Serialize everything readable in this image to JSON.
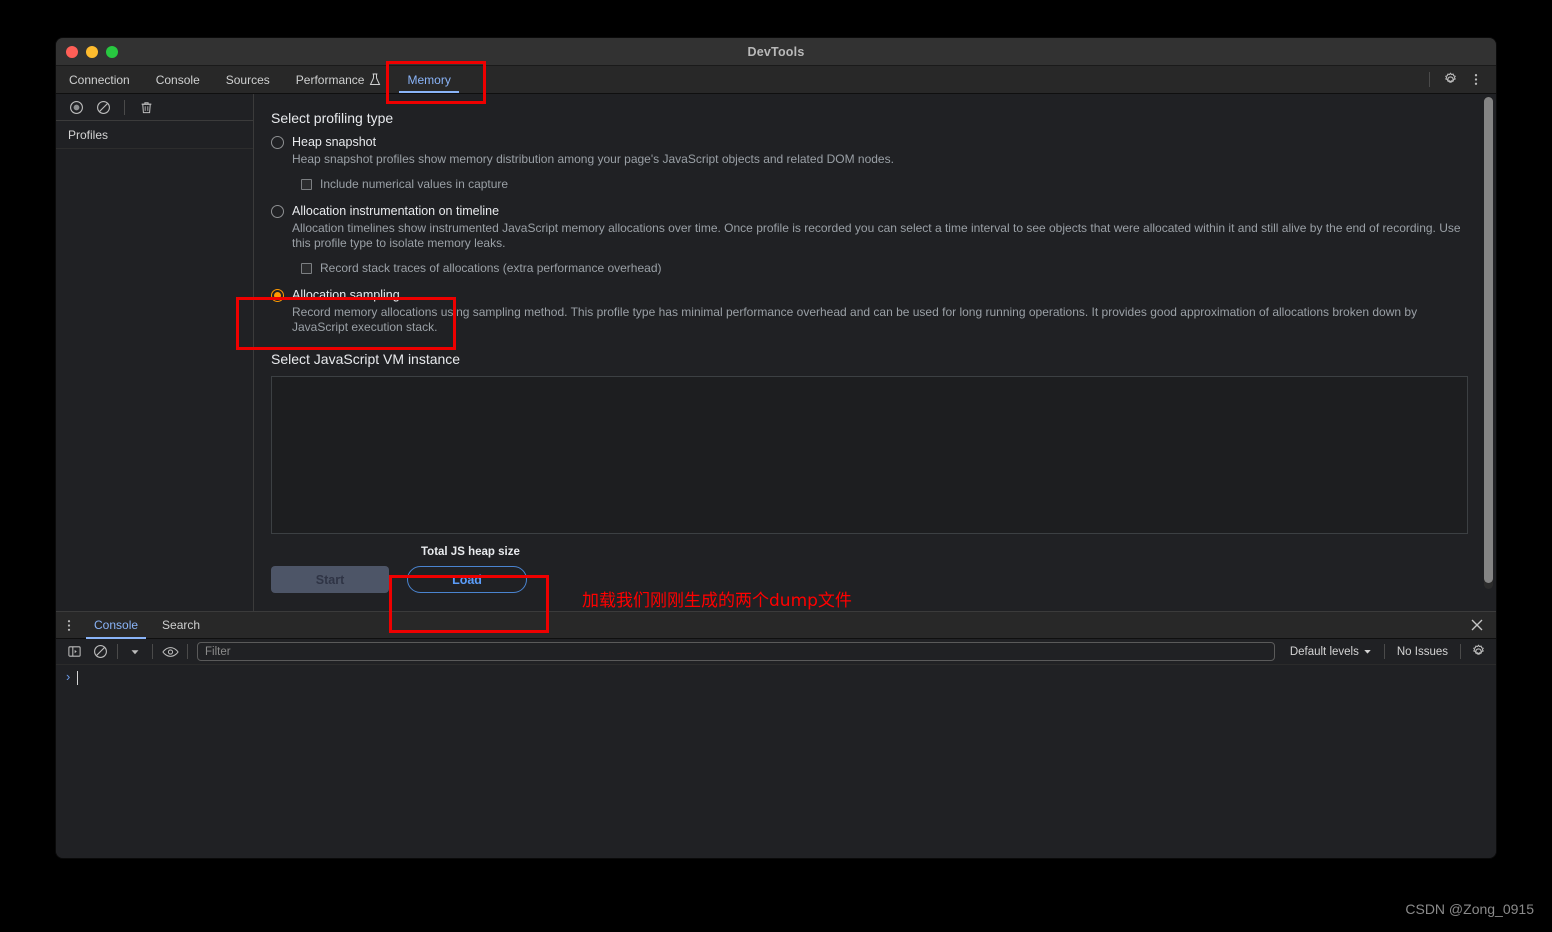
{
  "window": {
    "title": "DevTools",
    "traffic_lights": [
      "close",
      "minimize",
      "maximize"
    ]
  },
  "main_tabs": [
    {
      "label": "Connection",
      "active": false,
      "icon": null
    },
    {
      "label": "Console",
      "active": false,
      "icon": null
    },
    {
      "label": "Sources",
      "active": false,
      "icon": null
    },
    {
      "label": "Performance",
      "active": false,
      "icon": "flask-icon"
    },
    {
      "label": "Memory",
      "active": true,
      "icon": null
    }
  ],
  "main_tabbar_right": {
    "settings_icon": "gear-icon",
    "more_icon": "more-vertical-icon"
  },
  "sidebar": {
    "toolbar_icons": [
      "record-icon",
      "clear-icon",
      "trash-icon"
    ],
    "header": "Profiles",
    "items": []
  },
  "launcher": {
    "profiling_type_title": "Select profiling type",
    "profile_types": [
      {
        "label": "Heap snapshot",
        "selected": false,
        "description": "Heap snapshot profiles show memory distribution among your page's JavaScript objects and related DOM nodes.",
        "option": {
          "label": "Include numerical values in capture",
          "checked": false
        }
      },
      {
        "label": "Allocation instrumentation on timeline",
        "selected": false,
        "description": "Allocation timelines show instrumented JavaScript memory allocations over time. Once profile is recorded you can select a time interval to see objects that were allocated within it and still alive by the end of recording. Use this profile type to isolate memory leaks.",
        "option": {
          "label": "Record stack traces of allocations (extra performance overhead)",
          "checked": false
        }
      },
      {
        "label": "Allocation sampling",
        "selected": true,
        "description": "Record memory allocations using sampling method. This profile type has minimal performance overhead and can be used for long running operations. It provides good approximation of allocations broken down by JavaScript execution stack.",
        "option": null
      }
    ],
    "vm_section_title": "Select JavaScript VM instance",
    "vm_instances": [],
    "heap_size_label": "Total JS heap size",
    "start_button": "Start",
    "load_button": "Load"
  },
  "drawer": {
    "more_icon": "more-vertical-icon",
    "tabs": [
      {
        "label": "Console",
        "active": true
      },
      {
        "label": "Search",
        "active": false
      }
    ],
    "close_icon": "close-icon",
    "toolbar": {
      "sidebar_toggle_icon": "panel-toggle-icon",
      "clear_icon": "clear-icon",
      "context_dropdown_icon": "chevron-down-icon",
      "eye_icon": "eye-icon",
      "filter_placeholder": "Filter",
      "filter_value": "",
      "levels_label": "Default levels",
      "levels_dropdown_icon": "chevron-down-icon",
      "issues_label": "No Issues",
      "settings_icon": "gear-icon"
    },
    "prompt": {
      "caret": "›",
      "value": ""
    }
  },
  "annotations": {
    "note_text": "加载我们刚刚生成的两个dump文件",
    "box_color": "#ee0000",
    "boxes": [
      "memory-tab",
      "allocation-sampling",
      "load-button"
    ]
  },
  "watermark": "CSDN @Zong_0915",
  "colors": {
    "accent_blue": "#8ab4f8",
    "selected_radio": "#ff9800",
    "annotation_red": "#ee0000",
    "window_bg": "#202124",
    "titlebar_bg": "#323232"
  }
}
